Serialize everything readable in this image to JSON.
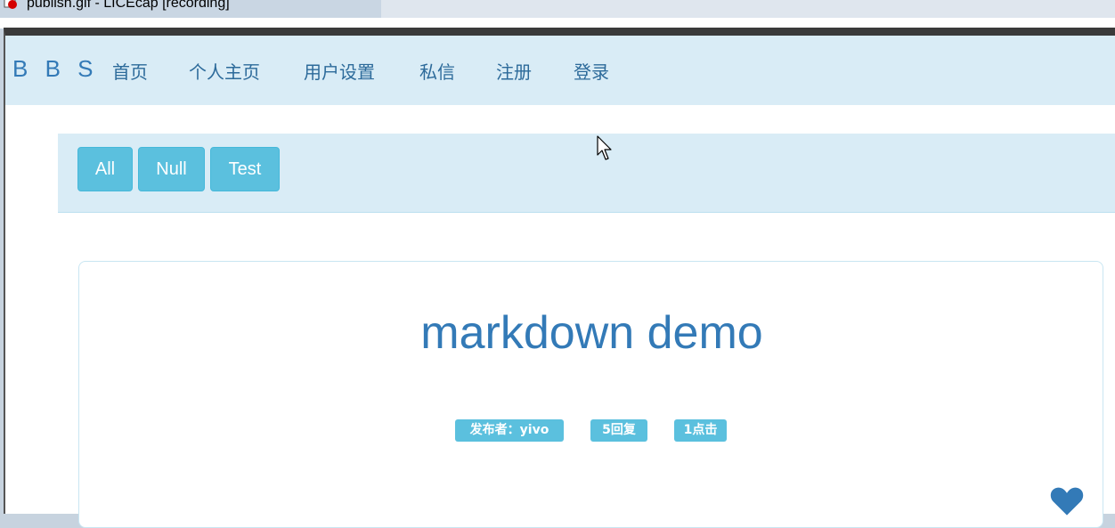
{
  "window": {
    "title": "publish.gif - LICEcap [recording]"
  },
  "navbar": {
    "brand": "B B S",
    "items": [
      {
        "label": "首页"
      },
      {
        "label": "个人主页"
      },
      {
        "label": "用户设置"
      },
      {
        "label": "私信"
      },
      {
        "label": "注册"
      },
      {
        "label": "登录"
      }
    ]
  },
  "filters": {
    "buttons": [
      {
        "label": "All"
      },
      {
        "label": "Null"
      },
      {
        "label": "Test"
      }
    ]
  },
  "post": {
    "title": "markdown demo",
    "author_badge": "发布者：yivo",
    "replies_badge": "5回复",
    "clicks_badge": "1点击",
    "like_icon": "heart-icon"
  },
  "colors": {
    "accent": "#337ab7",
    "info": "#5bc0de",
    "navbar_bg": "#d9ecf6"
  }
}
